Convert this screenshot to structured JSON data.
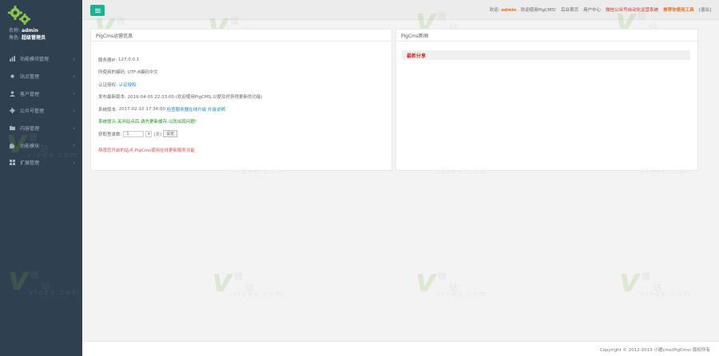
{
  "sidebar": {
    "user_name_label": "名称:",
    "user_name": "admin",
    "user_role_label": "角色:",
    "user_role": "超级管理员",
    "items": [
      {
        "label": "功能模块管理",
        "icon": "bar-chart-icon"
      },
      {
        "label": "站点管理",
        "icon": "dot-icon"
      },
      {
        "label": "客户管理",
        "icon": "user-icon"
      },
      {
        "label": "公众号管理",
        "icon": "gear-icon"
      },
      {
        "label": "内容管理",
        "icon": "folder-icon"
      },
      {
        "label": "功能模块",
        "icon": "puzzle-icon"
      },
      {
        "label": "扩展管理",
        "icon": "grid-icon"
      }
    ]
  },
  "topbar": {
    "welcome_prefix": "欢迎:",
    "welcome_user": "admin",
    "welcome_suffix": "· 欢迎使用PigCMS!",
    "links": [
      "后台首页",
      "用户中心"
    ],
    "red_link": "微信公众号自动化运营系统",
    "orange_link": "推荐你使用工具",
    "logout": "[退出]"
  },
  "left_panel": {
    "title": "PigCms运营信息",
    "rows": {
      "version_label": "服务器IP:",
      "version_value": "127.0.0.1",
      "encoding_label": "所使用的编码:",
      "encoding_value": "UTF-8编码中文",
      "auth_label": "认证授权:",
      "auth_value": "认证授权",
      "release_label": "发布最新版本:",
      "release_value": "2016-04-05 22:33:00 (欢迎使用PigCMS,以便及时获得更新的功能)",
      "system_label": "系统版本:",
      "system_value": "2017-02-10 17:34:00",
      "system_link1": "检查服务器在线升级",
      "system_link2": "升级说明",
      "notice": "系统提示:关闭站点后,请先更新缓存,以防出现问题!",
      "limit_label": "获取登录数:",
      "limit_value": "1",
      "limit_unit": "(天)",
      "set_button": "设定",
      "footer_notice": "恭喜您开启的站点,PigCms使用在线更新服务功能"
    }
  },
  "right_panel": {
    "title": "PigCms新闻",
    "news_bar": "最新分享"
  },
  "footer": {
    "text": "Copyright © 2012-2013 小猪cms(PigCms) 版权所有"
  },
  "watermark": {
    "letter": "v",
    "char1": "微",
    "char2": "站",
    "url": "vioee.com"
  }
}
